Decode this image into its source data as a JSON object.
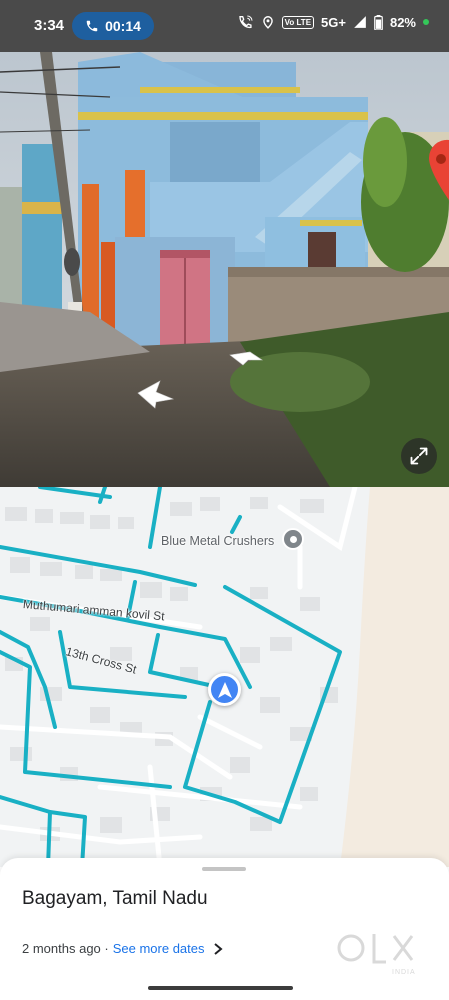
{
  "status_bar": {
    "time": "3:34",
    "call_timer": "00:14",
    "volte": "Vo LTE",
    "network": "5G+",
    "battery": "82%"
  },
  "street_view": {
    "icons": [
      "pin-icon",
      "left-arrow-icon",
      "right-arrow-icon",
      "expand-icon"
    ]
  },
  "map": {
    "poi_label": "Blue Metal Crushers",
    "streets": [
      "Muthumari amman kovil St",
      "13th Cross St"
    ],
    "colors": {
      "street_view_coverage": "#19b0c4",
      "location_marker": "#4285f4"
    }
  },
  "sheet": {
    "title": "Bagayam, Tamil Nadu",
    "date_prefix": "2 months ago ·",
    "see_more": "See more dates"
  },
  "watermark": {
    "logo_text": "OLX",
    "sub_text": "INDIA"
  }
}
